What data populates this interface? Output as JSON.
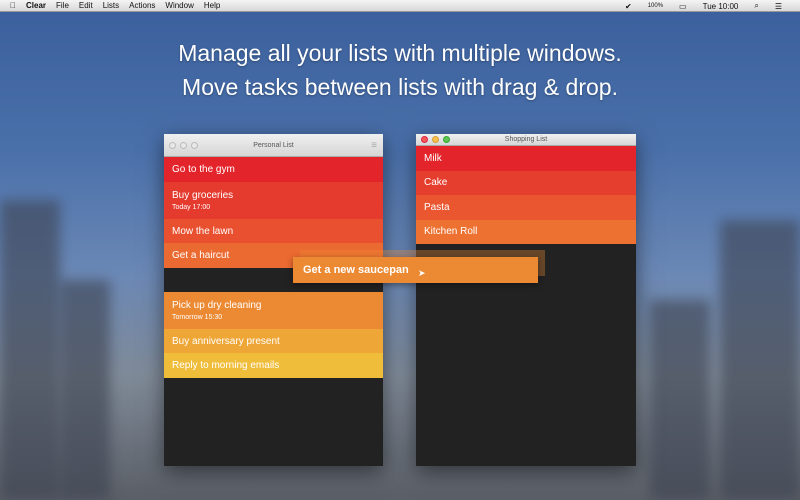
{
  "menubar": {
    "app": "Clear",
    "menus": [
      "File",
      "Edit",
      "Lists",
      "Actions",
      "Window",
      "Help"
    ],
    "battery": "100%",
    "clock": "Tue 10:00"
  },
  "headline": [
    "Manage all your lists with multiple windows.",
    "Move tasks between lists with drag & drop."
  ],
  "personal": {
    "title": "Personal List",
    "items": [
      {
        "label": "Go to the gym",
        "sub": "",
        "color": "#e3242b"
      },
      {
        "label": "Buy groceries",
        "sub": "Today 17:00",
        "color": "#e53a2e"
      },
      {
        "label": "Mow the lawn",
        "sub": "",
        "color": "#e8502f"
      },
      {
        "label": "Get a haircut",
        "sub": "",
        "color": "#eb6a31"
      },
      {
        "label": "",
        "sub": "",
        "color": "#222222"
      },
      {
        "label": "Pick up dry cleaning",
        "sub": "Tomorrow 15:30",
        "color": "#ec8a33"
      },
      {
        "label": "Buy anniversary present",
        "sub": "",
        "color": "#eea636"
      },
      {
        "label": "Reply to morning emails",
        "sub": "",
        "color": "#f0bd3a"
      }
    ]
  },
  "shopping": {
    "title": "Shopping List",
    "items": [
      {
        "label": "Milk",
        "color": "#e3242b"
      },
      {
        "label": "Cake",
        "color": "#e63e2e"
      },
      {
        "label": "Pasta",
        "color": "#e95630"
      },
      {
        "label": "Kitchen Roll",
        "color": "#ed7232"
      }
    ]
  },
  "dragged": {
    "label": "Get a new saucepan",
    "color": "#ec8a33"
  }
}
